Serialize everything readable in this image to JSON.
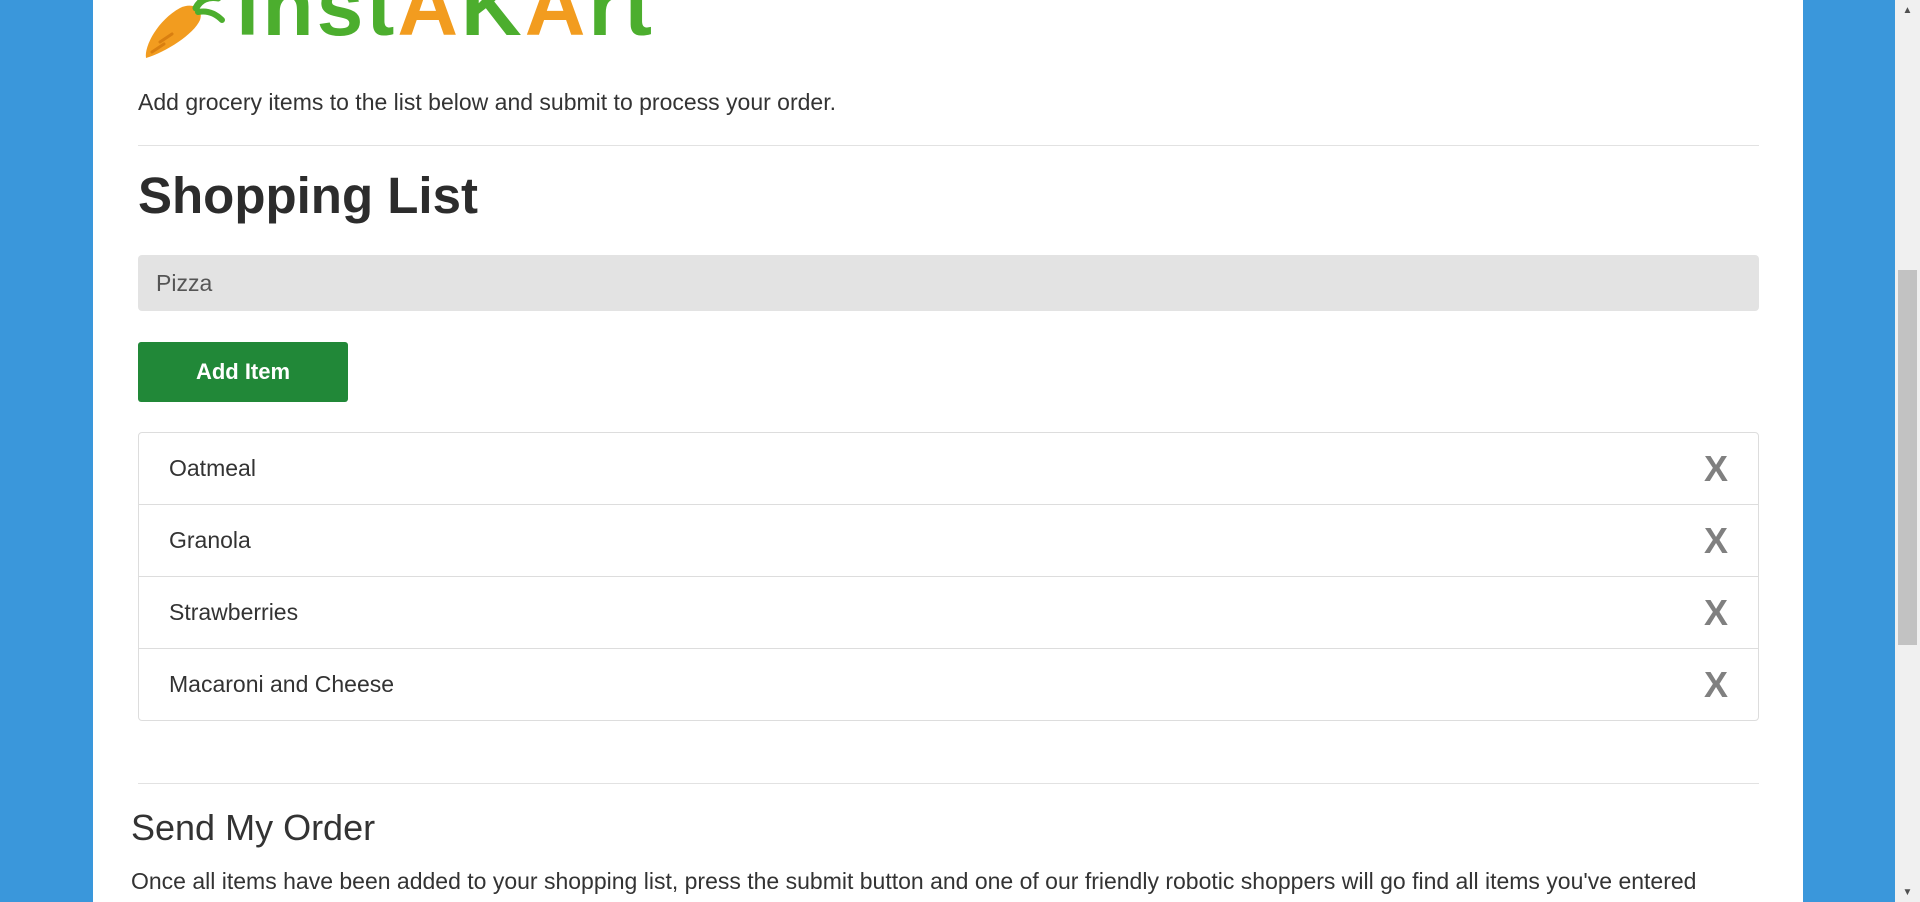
{
  "logo": {
    "text_start": "inst",
    "text_a1": "A",
    "text_k": "K",
    "text_a2": "A",
    "text_end": "rt",
    "icon": "carrot-icon",
    "brand_green": "#4cae2e",
    "brand_orange": "#f29c1f"
  },
  "intro_text": "Add grocery items to the list below and submit to process your order.",
  "shopping_list": {
    "title": "Shopping List",
    "input_value": "Pizza",
    "add_button_label": "Add Item",
    "items": [
      {
        "label": "Oatmeal",
        "remove": "X"
      },
      {
        "label": "Granola",
        "remove": "X"
      },
      {
        "label": "Strawberries",
        "remove": "X"
      },
      {
        "label": "Macaroni and Cheese",
        "remove": "X"
      }
    ]
  },
  "send_order": {
    "title": "Send My Order",
    "text": "Once all items have been added to your shopping list, press the submit button and one of our friendly robotic shoppers will go find all items you've entered"
  },
  "colors": {
    "background": "#3a97db",
    "button": "#218838",
    "remove": "#808080"
  },
  "scrollbar": {
    "up_icon": "scroll-up-icon",
    "down_icon": "scroll-down-icon"
  }
}
